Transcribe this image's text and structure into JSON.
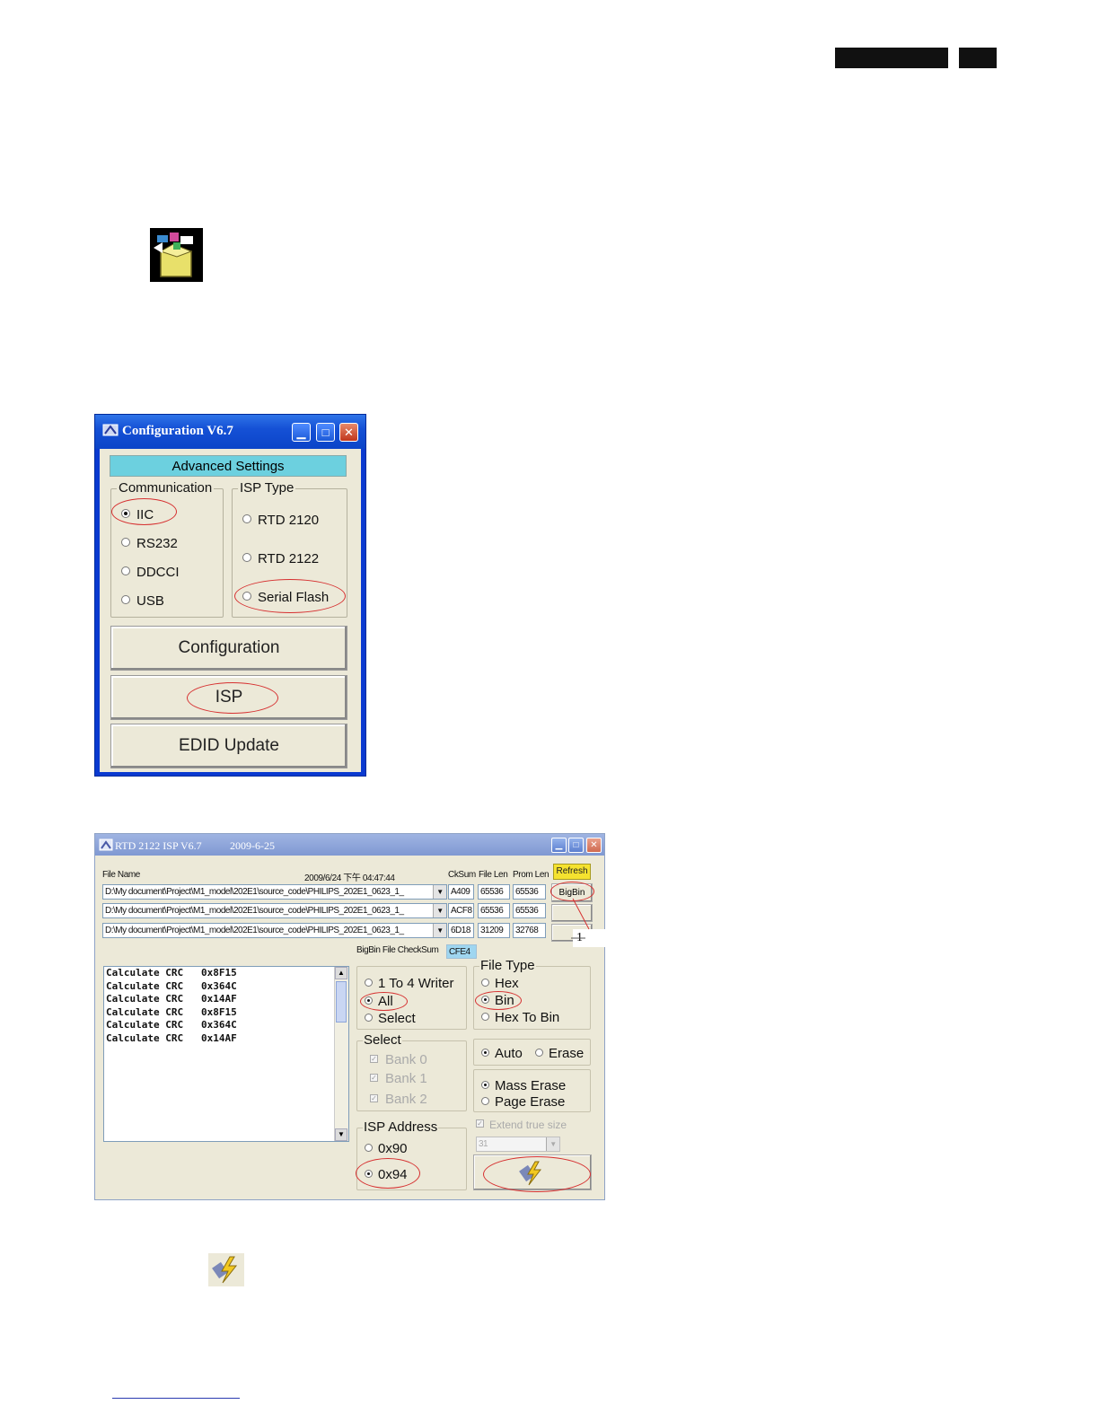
{
  "config_window": {
    "title": "Configuration V6.7",
    "advanced_settings": "Advanced Settings",
    "communication": {
      "label": "Communication",
      "options": [
        "IIC",
        "RS232",
        "DDCCI",
        "USB"
      ],
      "selected": "IIC"
    },
    "isp_type": {
      "label": "ISP Type",
      "options": [
        "RTD 2120",
        "RTD 2122",
        "Serial Flash"
      ]
    },
    "buttons": [
      "Configuration",
      "ISP",
      "EDID Update"
    ]
  },
  "isp_window": {
    "title": "RTD 2122 ISP V6.7",
    "date": "2009-6-25",
    "file_name_label": "File Name",
    "timestamp": "2009/6/24 下午 04:47:44",
    "col_cksum": "CkSum",
    "col_file_len": "File Len",
    "col_prom_len": "Prom Len",
    "refresh_label": "Refresh",
    "bigbin_label": "BigBin",
    "callout_number": "1",
    "files": [
      {
        "path": "D:\\My document\\Project\\M1_model\\202E1\\source_code\\PHILIPS_202E1_0623_1_",
        "cksum": "A409",
        "file_len": "65536",
        "prom_len": "65536"
      },
      {
        "path": "D:\\My document\\Project\\M1_model\\202E1\\source_code\\PHILIPS_202E1_0623_1_",
        "cksum": "ACF8",
        "file_len": "65536",
        "prom_len": "65536"
      },
      {
        "path": "D:\\My document\\Project\\M1_model\\202E1\\source_code\\PHILIPS_202E1_0623_1_",
        "cksum": "6D18",
        "file_len": "31209",
        "prom_len": "32768"
      }
    ],
    "bigbin_checksum_label": "BigBin File CheckSum",
    "bigbin_checksum_value": "CFE4",
    "log": [
      "Calculate CRC   0x8F15",
      "Calculate CRC   0x364C",
      "Calculate CRC   0x14AF",
      "Calculate CRC   0x8F15",
      "Calculate CRC   0x364C",
      "Calculate CRC   0x14AF"
    ],
    "writer_mode": {
      "options": [
        "1 To 4 Writer",
        "All",
        "Select"
      ],
      "selected": "All"
    },
    "file_type": {
      "label": "File Type",
      "options": [
        "Hex",
        "Bin",
        "Hex To Bin"
      ],
      "selected": "Bin"
    },
    "select_group": {
      "label": "Select",
      "banks": [
        "Bank 0",
        "Bank 1",
        "Bank 2"
      ]
    },
    "auto_label": "Auto",
    "erase_label": "Erase",
    "erase_mode": {
      "options": [
        "Mass Erase",
        "Page Erase"
      ],
      "selected": "Mass Erase"
    },
    "extend_true_size": "Extend true size",
    "size_value": "31",
    "isp_address": {
      "label": "ISP Address",
      "options": [
        "0x90",
        "0x94"
      ],
      "selected": "0x94"
    }
  },
  "colors": {
    "highlight_oval": "#d63030",
    "xp_titlebar": "#1551d6",
    "window_bg": "#ece9d8"
  }
}
